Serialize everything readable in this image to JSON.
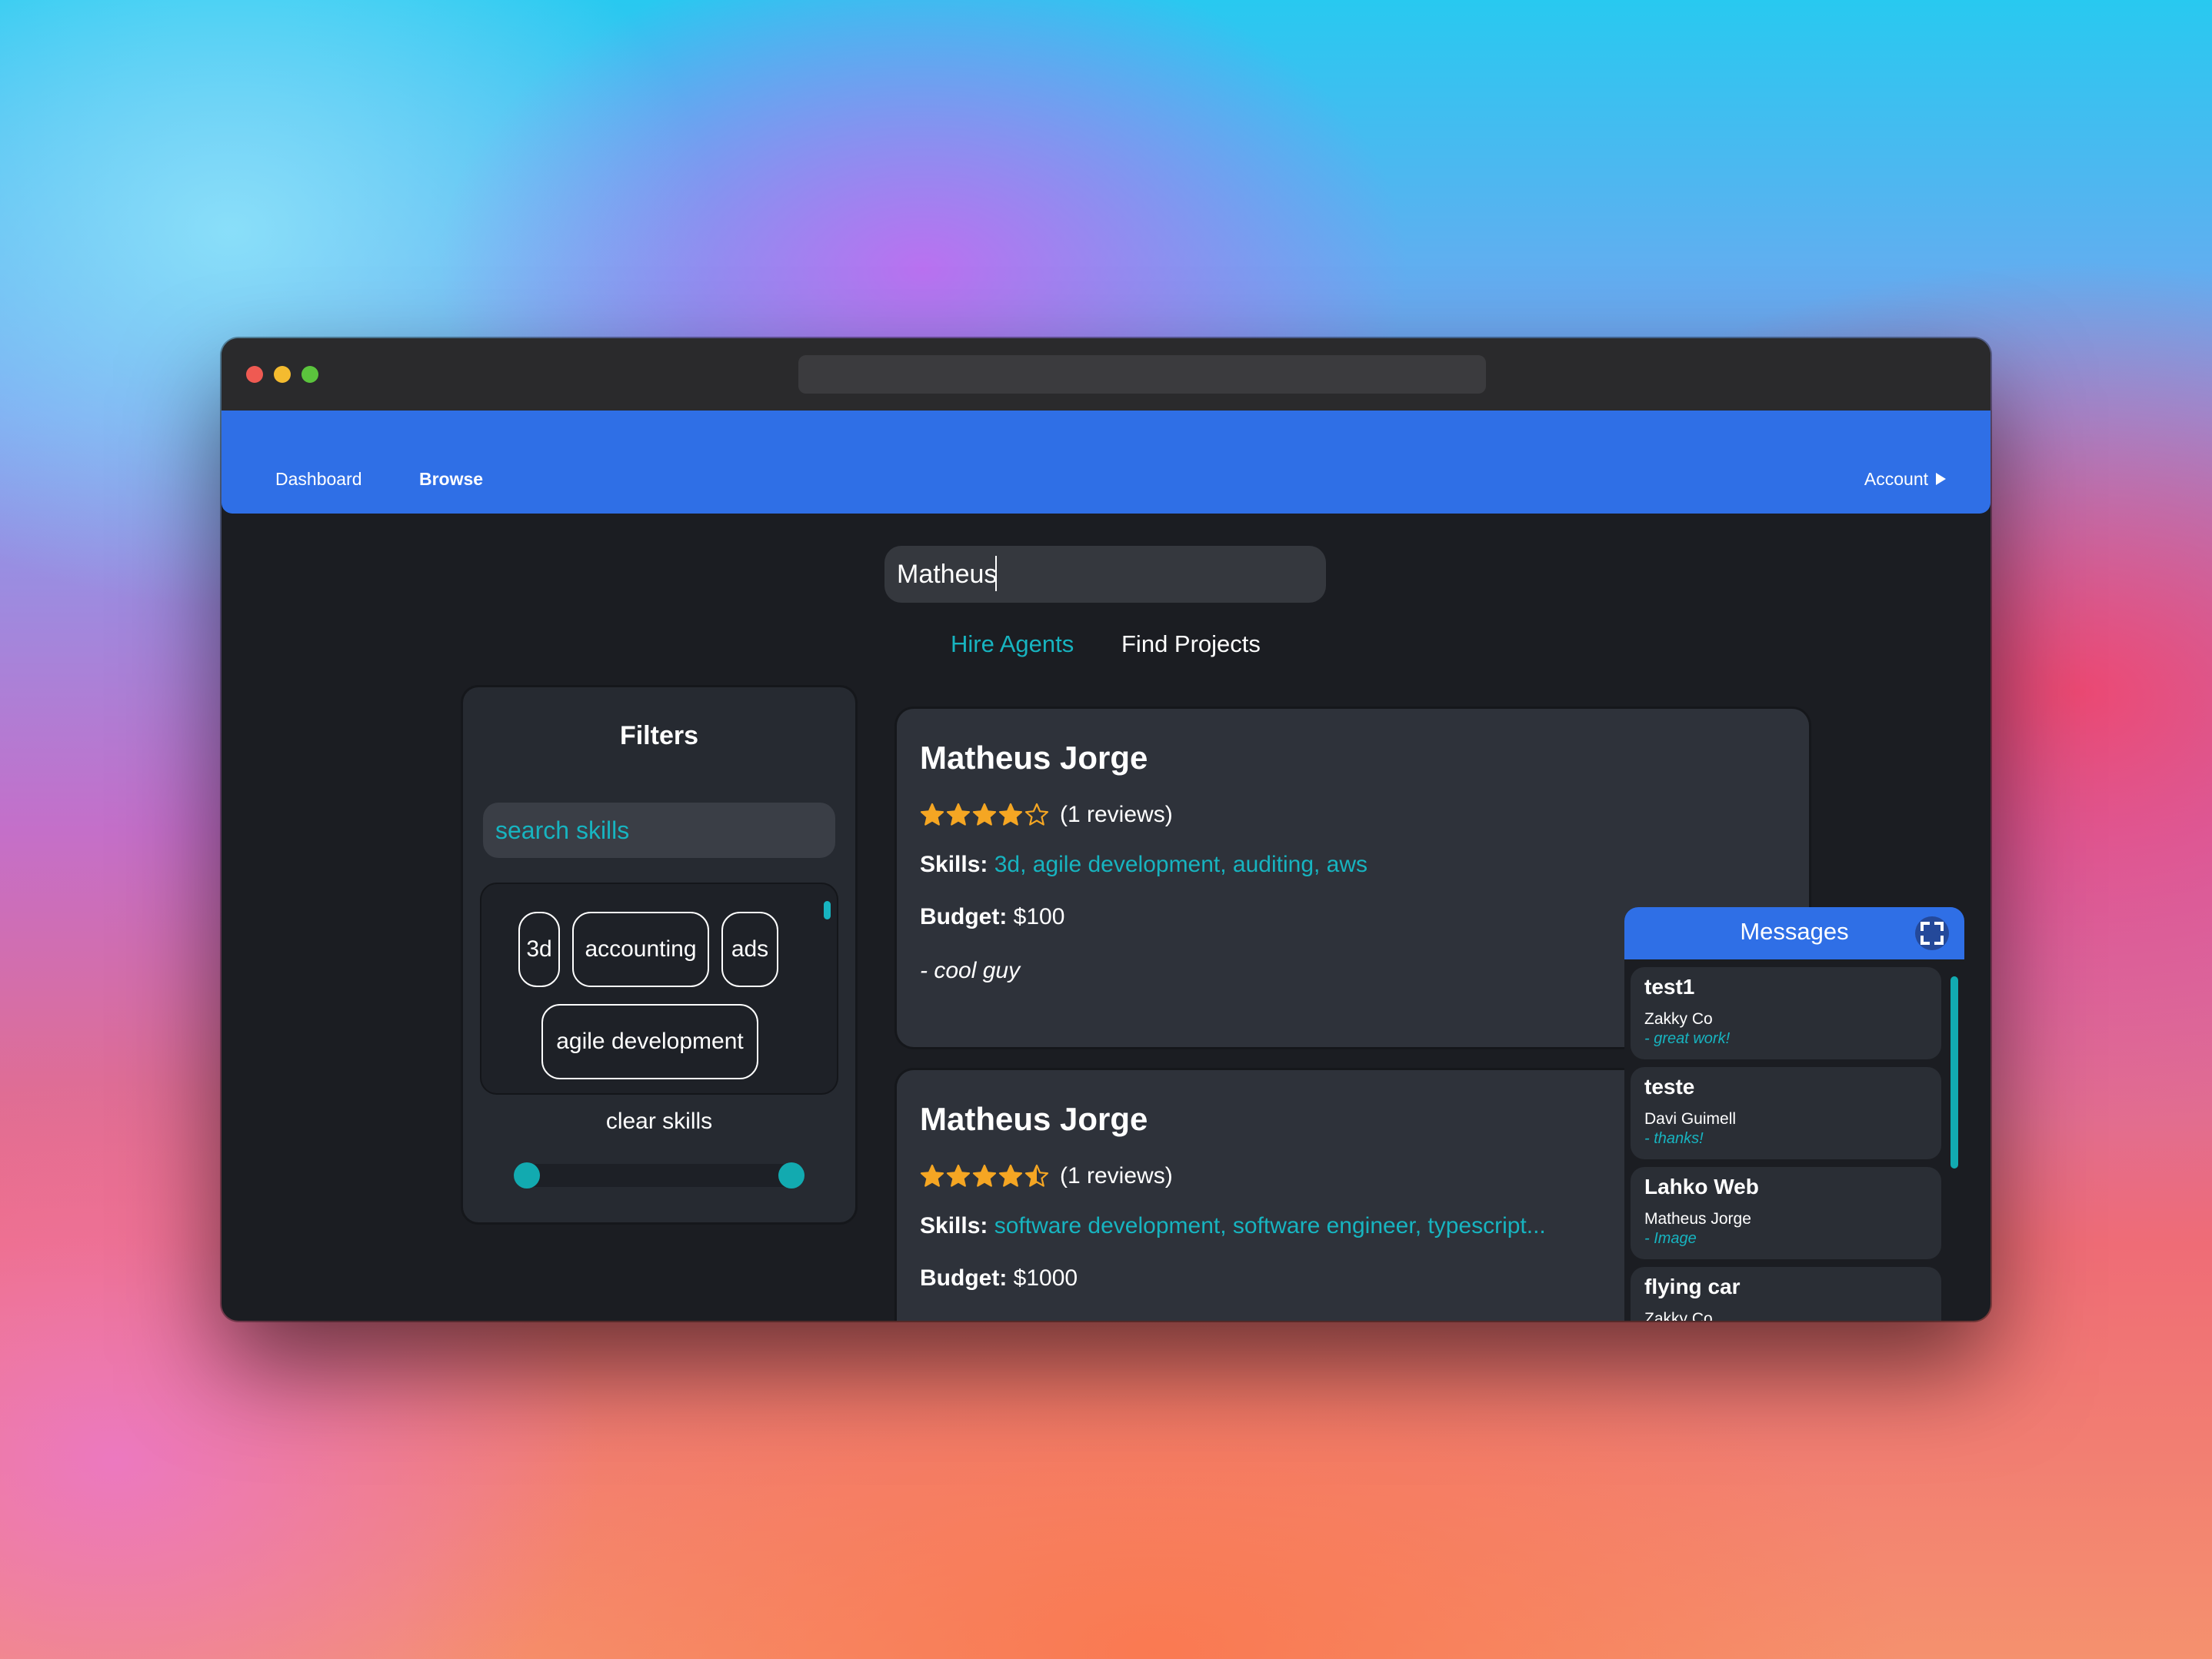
{
  "nav": {
    "dashboard": "Dashboard",
    "browse": "Browse",
    "account": "Account"
  },
  "search": {
    "value": "Matheus"
  },
  "tabs": {
    "hire": "Hire Agents",
    "find": "Find Projects"
  },
  "filters": {
    "title": "Filters",
    "skill_placeholder": "search skills",
    "chips": [
      "3d",
      "accounting",
      "ads",
      "agile development"
    ],
    "clear_label": "clear skills",
    "range": {
      "min": 0,
      "max": 1
    }
  },
  "cards": [
    {
      "name": "Matheus Jorge",
      "rating": 4,
      "reviews": "(1 reviews)",
      "skills_label": "Skills:",
      "skills": "3d, agile development, auditing, aws",
      "budget_label": "Budget:",
      "budget": "$100",
      "quote": "- cool guy"
    },
    {
      "name": "Matheus Jorge",
      "rating": 4.5,
      "reviews": "(1 reviews)",
      "skills_label": "Skills:",
      "skills": "software development, software engineer, typescript...",
      "budget_label": "Budget:",
      "budget": "$1000"
    }
  ],
  "messages": {
    "title": "Messages",
    "items": [
      {
        "title": "test1",
        "from": "Zakky Co",
        "preview": "- great work!"
      },
      {
        "title": "teste",
        "from": "Davi Guimell",
        "preview": "- thanks!"
      },
      {
        "title": "Lahko Web",
        "from": "Matheus Jorge",
        "preview": "- Image"
      },
      {
        "title": "flying car",
        "from": "Zakky Co",
        "preview": ""
      }
    ]
  },
  "colors": {
    "accent": "#17b4c0",
    "navbar": "#2f6fe6",
    "star": "#f5a623",
    "background": "#1b1d22"
  }
}
